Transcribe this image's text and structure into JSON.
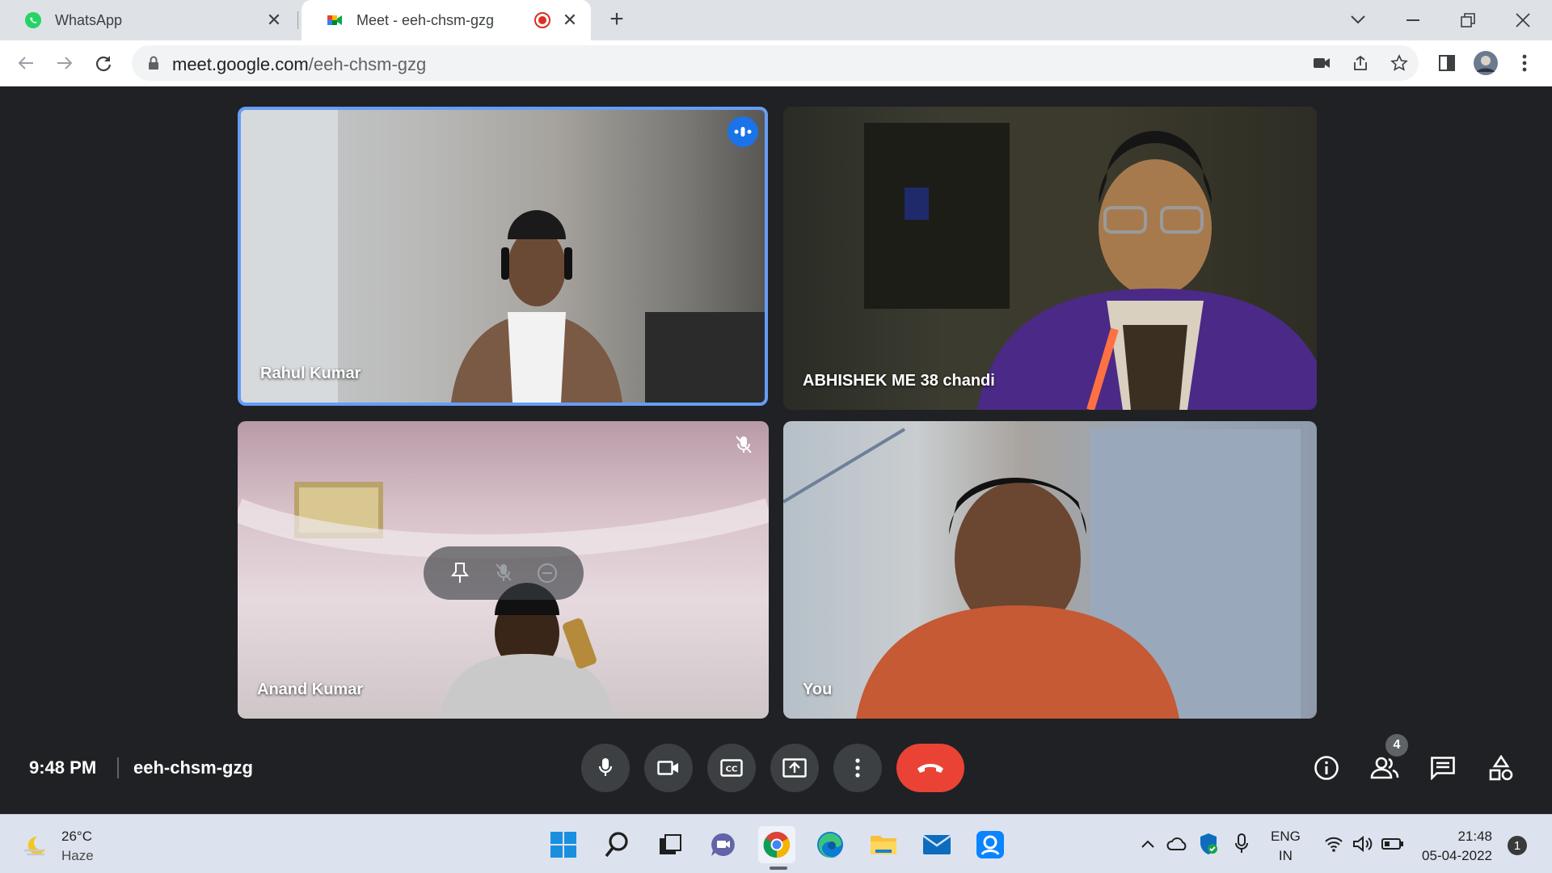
{
  "browser": {
    "tabs": [
      {
        "label": "WhatsApp",
        "active": false
      },
      {
        "label": "Meet - eeh-chsm-gzg",
        "active": true,
        "recording": true
      }
    ],
    "url_host": "meet.google.com",
    "url_path": "/eeh-chsm-gzg"
  },
  "meet": {
    "participants": [
      {
        "name": "Rahul Kumar",
        "speaking": true,
        "muted": false
      },
      {
        "name": "ABHISHEK ME 38 chandi",
        "speaking": false,
        "muted": false
      },
      {
        "name": "Anand Kumar",
        "speaking": false,
        "muted": true
      },
      {
        "name": "You",
        "speaking": false,
        "muted": false
      }
    ],
    "time": "9:48 PM",
    "meeting_code": "eeh-chsm-gzg",
    "people_count": "4",
    "controls": [
      "microphone",
      "camera",
      "captions",
      "present-screen",
      "more-options",
      "leave-call"
    ],
    "right_controls": [
      "meeting-details",
      "people",
      "chat",
      "activities"
    ],
    "hangup_color": "#ea4335",
    "speaking_color": "#1a73e8"
  },
  "taskbar": {
    "weather_temp": "26°C",
    "weather_desc": "Haze",
    "lang_line1": "ENG",
    "lang_line2": "IN",
    "clock_time": "21:48",
    "clock_date": "05-04-2022",
    "notifications": "1"
  }
}
